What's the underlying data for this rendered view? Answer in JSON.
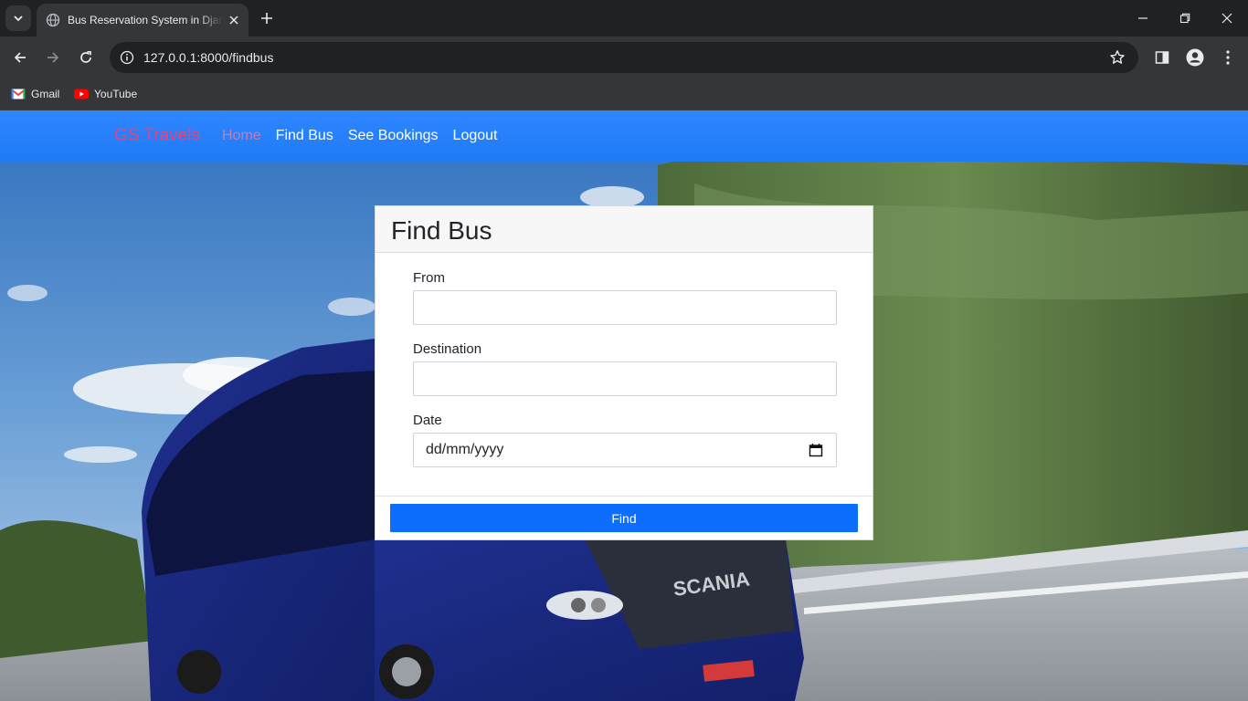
{
  "browser": {
    "tab_title": "Bus Reservation System in Django",
    "url": "127.0.0.1:8000/findbus",
    "bookmarks": [
      {
        "label": "Gmail",
        "icon": "gmail-icon"
      },
      {
        "label": "YouTube",
        "icon": "youtube-icon"
      }
    ]
  },
  "navbar": {
    "brand": "GS Travels",
    "links": [
      "Home",
      "Find Bus",
      "See Bookings",
      "Logout"
    ],
    "active": "Home",
    "brand_color": "#e8437b",
    "bar_color": "#2a82fb"
  },
  "card": {
    "title": "Find Bus",
    "fields": {
      "from_label": "From",
      "from_value": "",
      "destination_label": "Destination",
      "destination_value": "",
      "date_label": "Date",
      "date_placeholder": "dd/mm/yyyy"
    },
    "button_label": "Find",
    "button_color": "#0d6efd"
  }
}
